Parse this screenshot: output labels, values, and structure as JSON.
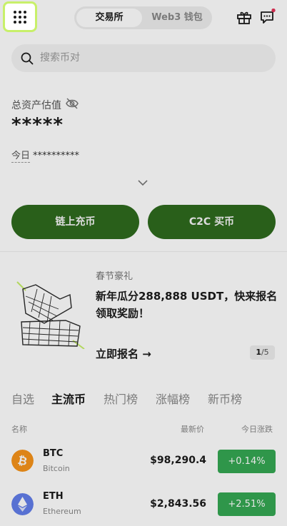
{
  "header": {
    "tabs": [
      "交易所",
      "Web3 钱包"
    ],
    "active_tab": "交易所"
  },
  "search": {
    "placeholder": "搜索币对"
  },
  "assets": {
    "label": "总资产估值",
    "hidden_value": "*****",
    "today_label": "今日",
    "today_value": "**********"
  },
  "actions": {
    "deposit_label": "链上充币",
    "c2c_label": "C2C 买币"
  },
  "banner": {
    "subtitle": "春节豪礼",
    "title": "新年瓜分288,888 USDT，快来报名领取奖励！",
    "cta": "立即报名 →",
    "page_current": "1",
    "page_total": "/5"
  },
  "market_tabs": [
    "自选",
    "主流币",
    "热门榜",
    "涨幅榜",
    "新币榜"
  ],
  "active_market_tab": "主流币",
  "columns": {
    "name": "名称",
    "price": "最新价",
    "change": "今日涨跌"
  },
  "rows": [
    {
      "symbol": "BTC",
      "name": "Bitcoin",
      "price": "$98,290.4",
      "change": "+0.14%",
      "icon": "bitcoin-icon",
      "icon_color": "#f7931a"
    },
    {
      "symbol": "ETH",
      "name": "Ethereum",
      "price": "$2,843.56",
      "change": "+2.51%",
      "icon": "ethereum-icon",
      "icon_color": "#627eea"
    }
  ],
  "colors": {
    "accent_green": "#2e6a1e",
    "up_green": "#35a853",
    "menu_highlight": "#c8f06a",
    "notify_dot": "#e5345a"
  }
}
